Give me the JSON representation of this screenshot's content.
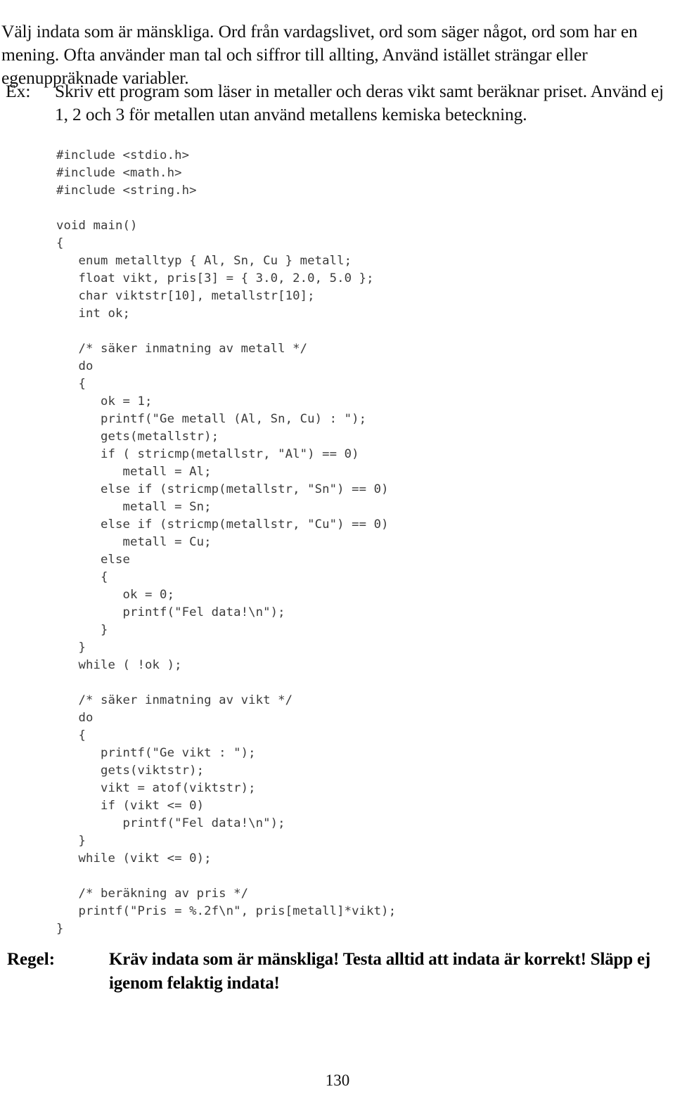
{
  "document": {
    "intro_paragraph": "Välj indata som är mänskliga. Ord från vardagslivet, ord som säger något, ord som har en mening. Ofta använder man tal och siffror till allting, Använd istället strängar eller egenuppräknade variabler.",
    "example": {
      "label": "Ex:",
      "text": "Skriv ett program som läser in metaller och deras vikt samt beräknar priset. Använd ej 1, 2 och 3 för metallen utan använd metallens kemiska beteckning."
    },
    "code_listing": {
      "language": "c",
      "lines": [
        "#include <stdio.h>",
        "#include <math.h>",
        "#include <string.h>",
        "",
        "void main()",
        "{",
        "   enum metalltyp { Al, Sn, Cu } metall;",
        "   float vikt, pris[3] = { 3.0, 2.0, 5.0 };",
        "   char viktstr[10], metallstr[10];",
        "   int ok;",
        "",
        "   /* säker inmatning av metall */",
        "   do",
        "   {",
        "      ok = 1;",
        "      printf(\"Ge metall (Al, Sn, Cu) : \");",
        "      gets(metallstr);",
        "      if ( stricmp(metallstr, \"Al\") == 0)",
        "         metall = Al;",
        "      else if (stricmp(metallstr, \"Sn\") == 0)",
        "         metall = Sn;",
        "      else if (stricmp(metallstr, \"Cu\") == 0)",
        "         metall = Cu;",
        "      else",
        "      {",
        "         ok = 0;",
        "         printf(\"Fel data!\\n\");",
        "      }",
        "   }",
        "   while ( !ok );",
        "",
        "   /* säker inmatning av vikt */",
        "   do",
        "   {",
        "      printf(\"Ge vikt : \");",
        "      gets(viktstr);",
        "      vikt = atof(viktstr);",
        "      if (vikt <= 0)",
        "         printf(\"Fel data!\\n\");",
        "   }",
        "   while (vikt <= 0);",
        "",
        "   /* beräkning av pris */",
        "   printf(\"Pris = %.2f\\n\", pris[metall]*vikt);",
        "}"
      ]
    },
    "rule": {
      "label": "Regel:",
      "text": "Kräv indata som är mänskliga! Testa alltid att indata är korrekt! Släpp ej igenom felaktig indata!"
    },
    "footer": {
      "page_number": "130"
    },
    "colors": {
      "background": "#ffffff",
      "body_text": "#111111",
      "code_text": "#3b3b3b",
      "rule_text": "#000000"
    }
  }
}
